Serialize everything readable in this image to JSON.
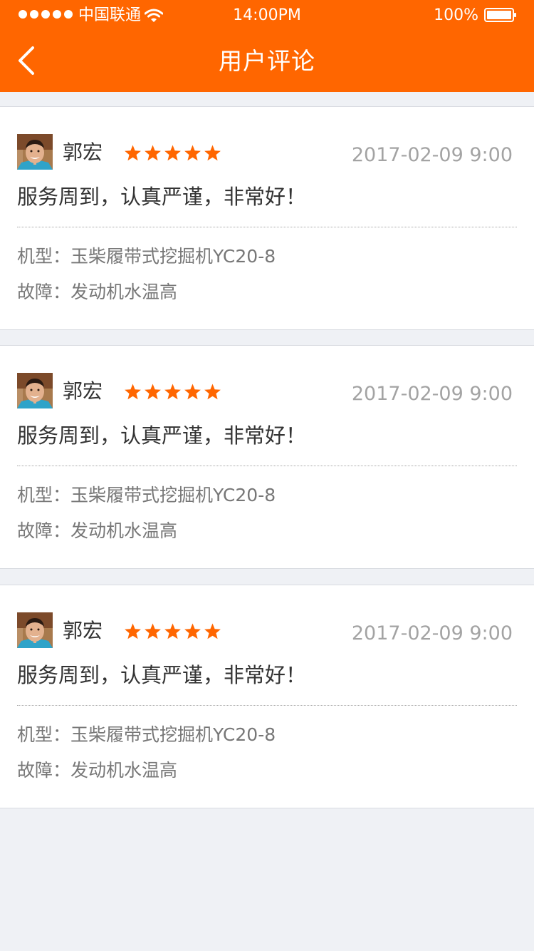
{
  "status_bar": {
    "carrier": "中国联通",
    "time": "14:00PM",
    "battery": "100%"
  },
  "nav": {
    "title": "用户评论",
    "back_icon": "chevron-left-icon"
  },
  "colors": {
    "accent": "#ff6600",
    "background": "#eff1f5",
    "star": "#ff6600"
  },
  "reviews": [
    {
      "user": "郭宏",
      "rating": 5,
      "date": "2017-02-09 9:00",
      "comment": "服务周到，认真严谨，非常好！",
      "model_label": "机型：",
      "model": "玉柴履带式挖掘机YC20-8",
      "fault_label": "故障：",
      "fault": "发动机水温高"
    },
    {
      "user": "郭宏",
      "rating": 5,
      "date": "2017-02-09 9:00",
      "comment": "服务周到，认真严谨，非常好！",
      "model_label": "机型：",
      "model": "玉柴履带式挖掘机YC20-8",
      "fault_label": "故障：",
      "fault": "发动机水温高"
    },
    {
      "user": "郭宏",
      "rating": 5,
      "date": "2017-02-09 9:00",
      "comment": "服务周到，认真严谨，非常好！",
      "model_label": "机型：",
      "model": "玉柴履带式挖掘机YC20-8",
      "fault_label": "故障：",
      "fault": "发动机水温高"
    }
  ]
}
